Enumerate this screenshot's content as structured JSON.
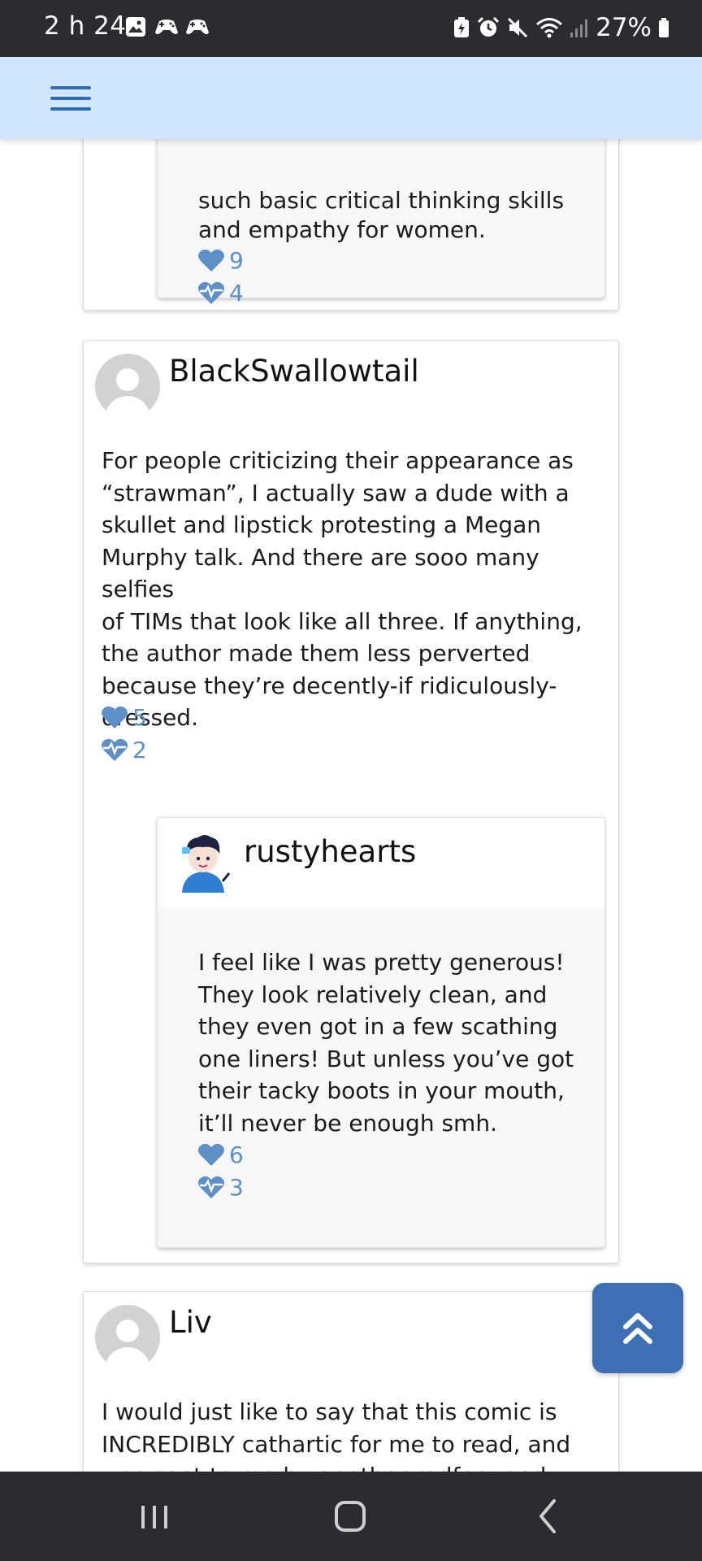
{
  "status_bar": {
    "time": "2 h 24",
    "battery": "27%",
    "left_icons": [
      "gallery-icon",
      "game-controller-icon",
      "game-controller-icon"
    ],
    "right_icons": [
      "battery-saver-icon",
      "alarm-icon",
      "mute-icon",
      "wifi-icon",
      "signal-icon",
      "battery-icon"
    ]
  },
  "header": {
    "menu_icon": "hamburger-menu-icon",
    "background": "#d2e6fb",
    "accent": "#2f6db0"
  },
  "comments": [
    {
      "reply_fragment": {
        "text_clipped": "such basic critical thinking skills",
        "text": "and empathy for women.",
        "likes": "9",
        "hearts": "4"
      }
    },
    {
      "username": "BlackSwallowtail",
      "avatar": "default-avatar",
      "text": "For people criticizing their appearance as\n“strawman”, I actually saw a dude with a\nskullet and lipstick protesting a Megan\nMurphy talk. And there are sooo many selfies\nof TIMs that look like all three. If anything,\nthe author made them less perverted\nbecause they’re decently-if ridiculously-\ndressed.",
      "likes": "5",
      "hearts": "2",
      "reply": {
        "username": "rustyhearts",
        "avatar": "cartoon-avatar",
        "text": "I feel like I was pretty generous!\nThey look relatively clean, and\nthey even got in a few scathing\none liners! But unless you’ve got\ntheir tacky boots in your mouth,\nit’ll never be enough smh.",
        "likes": "6",
        "hearts": "3"
      }
    },
    {
      "username": "Liv",
      "avatar": "default-avatar",
      "text": "I would just like to say that this comic is\nINCREDIBLY cathartic for me to read, and\nwas sent to me by another radfem and"
    }
  ],
  "colors": {
    "stat_blue": "#5e8fc6",
    "fab": "#3f6fb3"
  },
  "scroll_top_icon": "double-chevron-up-icon",
  "nav_bar": {
    "icons": [
      "recent-apps-icon",
      "home-icon",
      "back-icon"
    ]
  }
}
